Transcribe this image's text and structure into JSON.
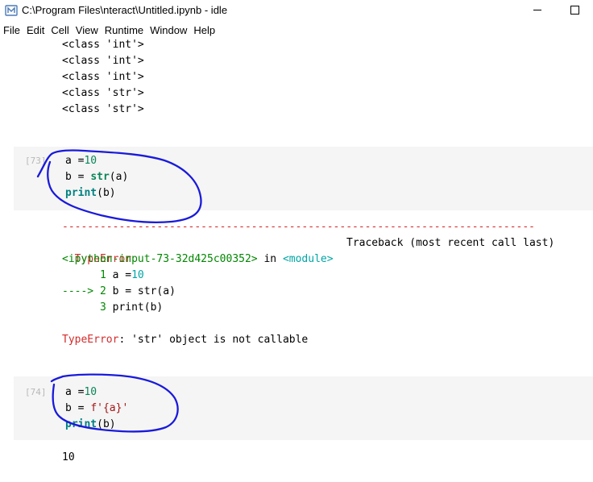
{
  "window": {
    "title": "C:\\Program Files\\nteract\\Untitled.ipynb - idle",
    "minimize_symbol": "—",
    "maximize_symbol": "☐"
  },
  "menu": [
    "File",
    "Edit",
    "Cell",
    "View",
    "Runtime",
    "Window",
    "Help"
  ],
  "top_outputs": [
    "<class 'int'>",
    "<class 'int'>",
    "<class 'int'>",
    "<class 'str'>",
    "<class 'str'>"
  ],
  "cell73": {
    "prompt": "[73]",
    "line1": {
      "a": "a =",
      "n": "10"
    },
    "line2": {
      "a": "b = ",
      "fn": "str",
      "rest": "(a)"
    },
    "line3": {
      "fn": "print",
      "rest": "(b)"
    }
  },
  "error73": {
    "dashes": "---------------------------------------------------------------------------",
    "type": "TypeError",
    "traceback_header": "Traceback (most recent call last)",
    "input_ref": "<ipython-input-73-32d425c00352>",
    "in_word": " in ",
    "module_ref": "<module>",
    "tb1": {
      "num": "      1 ",
      "code": "a =",
      "val": "10"
    },
    "tb2": {
      "arrow": "----> 2 ",
      "code": "b = str(a)"
    },
    "tb3": {
      "num": "      3 ",
      "code": "print(b)"
    },
    "final_type": "TypeError",
    "final_msg": ": 'str' object is not callable"
  },
  "cell74": {
    "prompt": "[74]",
    "line1": {
      "a": "a =",
      "n": "10"
    },
    "line2": {
      "a": "b = ",
      "s": "f'{a}'"
    },
    "line3": {
      "fn": "print",
      "rest": "(b)"
    }
  },
  "output74": "10",
  "colors": {
    "annotation_ink": "#1a1adb",
    "error_red": "#d42a2a",
    "cell_background": "#f5f5f5"
  }
}
